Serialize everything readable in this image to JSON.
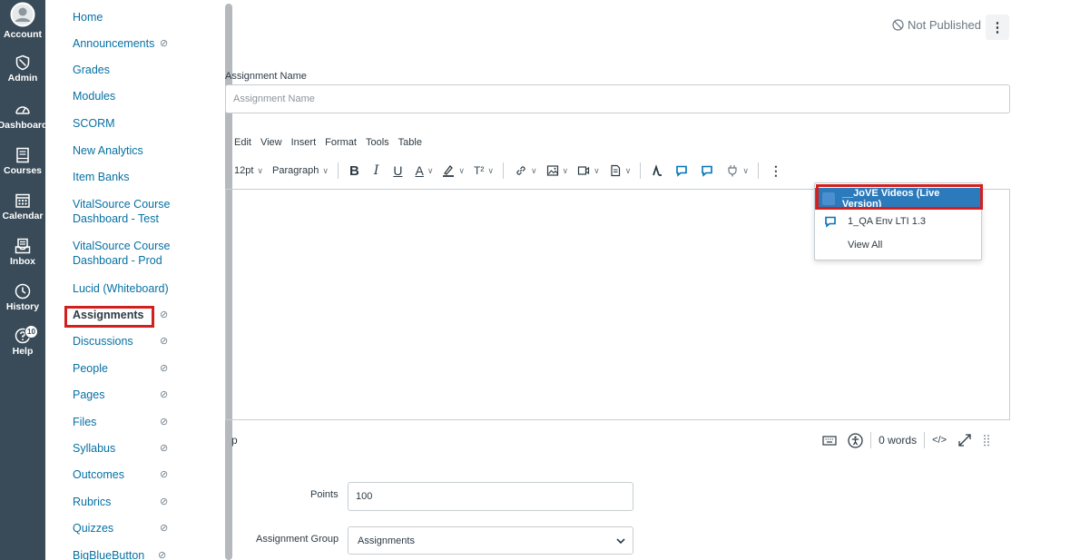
{
  "global_nav": {
    "account": "Account",
    "admin": "Admin",
    "dashboard": "Dashboard",
    "courses": "Courses",
    "calendar": "Calendar",
    "inbox": "Inbox",
    "history": "History",
    "help": "Help",
    "help_badge": "10"
  },
  "course_nav": {
    "items": [
      {
        "label": "Home"
      },
      {
        "label": "Announcements"
      },
      {
        "label": "Grades"
      },
      {
        "label": "Modules"
      },
      {
        "label": "SCORM"
      },
      {
        "label": "New Analytics"
      },
      {
        "label": "Item Banks"
      },
      {
        "label": "VitalSource Course",
        "label2": "Dashboard - Test"
      },
      {
        "label": "VitalSource Course",
        "label2": "Dashboard - Prod"
      },
      {
        "label": "Lucid (Whiteboard)"
      },
      {
        "label": "Assignments"
      },
      {
        "label": "Discussions"
      },
      {
        "label": "People"
      },
      {
        "label": "Pages"
      },
      {
        "label": "Files"
      },
      {
        "label": "Syllabus"
      },
      {
        "label": "Outcomes"
      },
      {
        "label": "Rubrics"
      },
      {
        "label": "Quizzes"
      },
      {
        "label": "BigBlueButton"
      }
    ]
  },
  "header": {
    "status": "Not Published",
    "kebab": "⋮"
  },
  "form": {
    "name_label": "Assignment Name",
    "name_placeholder": "Assignment Name",
    "points_label": "Points",
    "points_value": "100",
    "group_label": "Assignment Group",
    "group_value": "Assignments"
  },
  "editor": {
    "menus": [
      "Edit",
      "View",
      "Insert",
      "Format",
      "Tools",
      "Table"
    ],
    "font_size": "12pt",
    "block_format": "Paragraph",
    "superscript": "T²",
    "more": "⋮",
    "path": "p",
    "word_count": "0 words",
    "html_toggle": "</>"
  },
  "lti_menu": {
    "items": [
      "__JoVE Videos (Live Version)",
      "1_QA Env LTI 1.3",
      "View All"
    ]
  },
  "colors": {
    "nav_bg": "#394b58",
    "link": "#0770a3",
    "selected": "#2b7abc",
    "highlight": "#d2201f"
  }
}
